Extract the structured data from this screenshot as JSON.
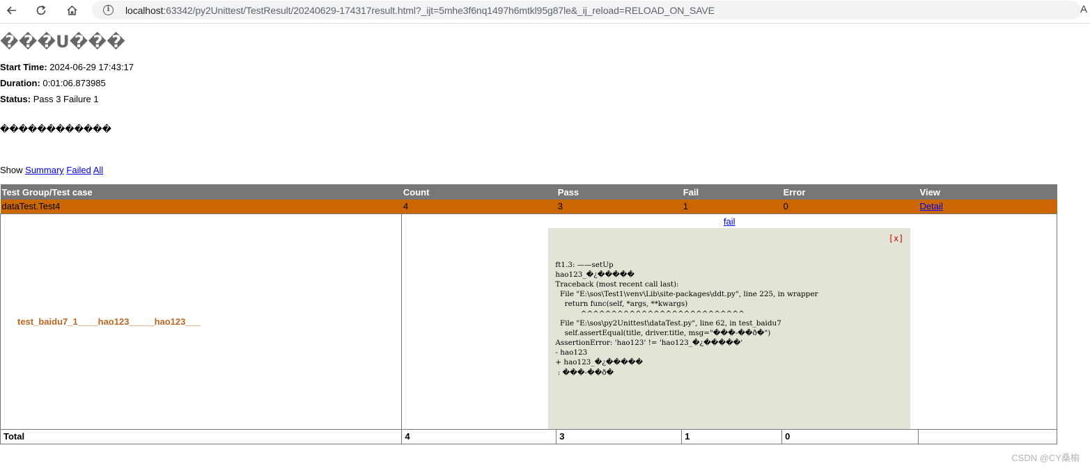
{
  "browser": {
    "url_host": "localhost",
    "url_rest": ":63342/py2Unittest/TestResult/20240629-174317result.html?_ijt=5mhe3f6nq1497h6mtkl95g87le&_ij_reload=RELOAD_ON_SAVE",
    "reader_label": "A"
  },
  "report": {
    "title": "���U���",
    "start_time_label": "Start Time:",
    "start_time": "2024-06-29 17:43:17",
    "duration_label": "Duration:",
    "duration": "0:01:06.873985",
    "status_label": "Status:",
    "status": "Pass 3 Failure 1",
    "description": "������������"
  },
  "filter": {
    "show_label": "Show",
    "summary": "Summary",
    "failed": "Failed",
    "all": "All"
  },
  "table": {
    "headers": [
      "Test Group/Test case",
      "Count",
      "Pass",
      "Fail",
      "Error",
      "View"
    ],
    "class_row": {
      "name": "dataTest.Test4",
      "count": "4",
      "pass": "3",
      "fail": "1",
      "error": "0",
      "view": "Detail"
    },
    "case_row": {
      "name": "test_baidu7_1____hao123_____hao123___",
      "status_link": "fail",
      "close": "[x]",
      "output": "ft1.3: ——setUp\nhao123_�¿�����\nTraceback (most recent call last):\n  File \"E:\\sos\\Test1\\venv\\Lib\\site-packages\\ddt.py\", line 225, in wrapper\n    return func(self, *args, **kwargs)\n           ^^^^^^^^^^^^^^^^^^^^^^^^^^^\n  File \"E:\\sos\\py2Unittest\\dataTest.py\", line 62, in test_baidu7\n    self.assertEqual(title, driver.title, msg=\"���-��ð�\")\nAssertionError: 'hao123' != 'hao123_�¿�����'\n- hao123\n+ hao123_�¿�����\n : ���-��ð�"
    },
    "total_row": {
      "label": "Total",
      "count": "4",
      "pass": "3",
      "fail": "1",
      "error": "0",
      "view": ""
    }
  },
  "watermark": "CSDN @CY桑榆"
}
